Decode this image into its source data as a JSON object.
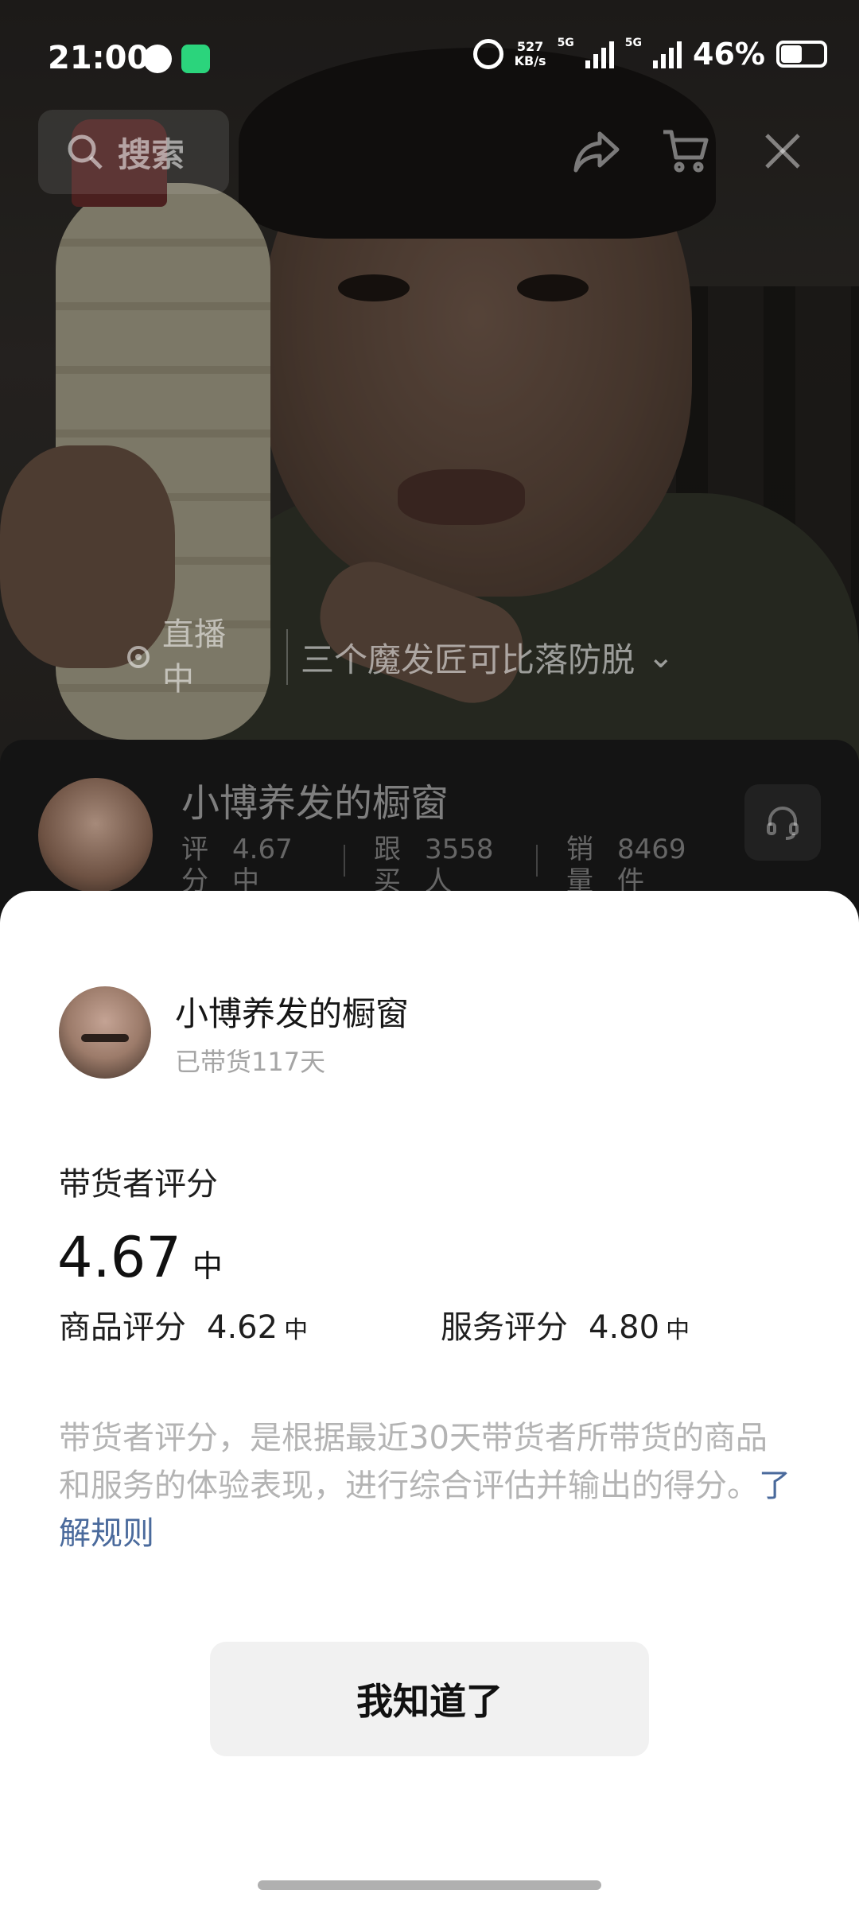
{
  "status_bar": {
    "time": "21:00",
    "net_speed_value": "527",
    "net_speed_unit": "KB/s",
    "network_1": "5G",
    "network_2": "5G",
    "battery": "46%",
    "battery_level": 0.46
  },
  "toolbar": {
    "search_label": "搜索",
    "icons": [
      "search-icon",
      "share-icon",
      "cart-icon",
      "close-icon"
    ]
  },
  "live": {
    "status": "直播中",
    "title": "三个魔发匠可比落防脱"
  },
  "store_card": {
    "name": "小博养发的橱窗",
    "stats": [
      {
        "label": "评分",
        "value": "4.67 中"
      },
      {
        "label": "跟买",
        "value": "3558 人"
      },
      {
        "label": "销量",
        "value": "8469 件"
      }
    ]
  },
  "sheet": {
    "seller_name": "小博养发的橱窗",
    "seller_subtitle": "已带货117天",
    "section_title": "带货者评分",
    "overall_score": "4.67",
    "overall_level": "中",
    "product_label": "商品评分",
    "product_score": "4.62",
    "product_level": "中",
    "service_label": "服务评分",
    "service_score": "4.80",
    "service_level": "中",
    "description": "带货者评分，是根据最近30天带货者所带货的商品和服务的体验表现，进行综合评估并输出的得分。",
    "rules_link": "了解规则",
    "confirm_button": "我知道了"
  },
  "colors": {
    "link": "#4a6a9c",
    "button_bg": "#f1f1f1",
    "muted_text": "#b4b4b4"
  }
}
